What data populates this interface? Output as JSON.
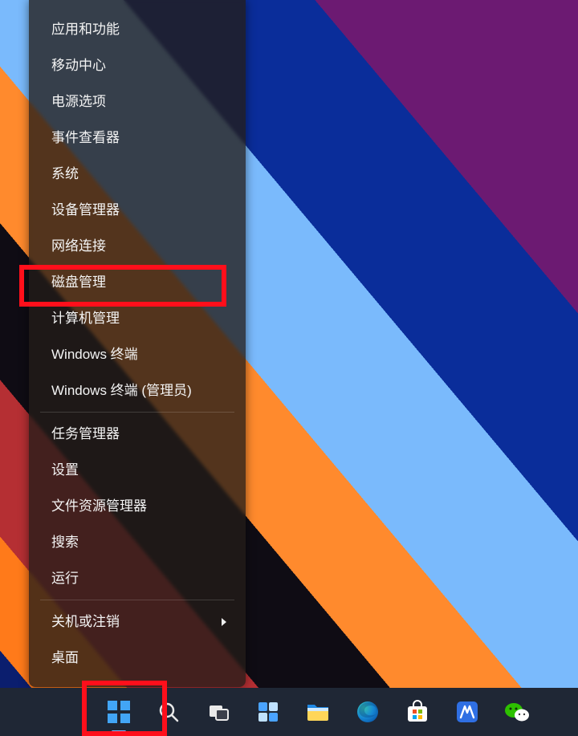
{
  "menu": {
    "items": [
      "应用和功能",
      "移动中心",
      "电源选项",
      "事件查看器",
      "系统",
      "设备管理器",
      "网络连接",
      "磁盘管理",
      "计算机管理",
      "Windows 终端",
      "Windows 终端 (管理员)",
      "任务管理器",
      "设置",
      "文件资源管理器",
      "搜索",
      "运行",
      "关机或注销",
      "桌面"
    ],
    "separators_after": [
      10,
      15
    ],
    "submenu_on": [
      16
    ],
    "highlight_index": 7
  },
  "taskbar": {
    "items": [
      {
        "name": "start",
        "icon": "start-icon",
        "active": true
      },
      {
        "name": "search",
        "icon": "search-icon"
      },
      {
        "name": "task-view",
        "icon": "task-view-icon"
      },
      {
        "name": "widgets",
        "icon": "widgets-icon"
      },
      {
        "name": "file-explorer",
        "icon": "file-explorer-icon"
      },
      {
        "name": "edge",
        "icon": "edge-icon"
      },
      {
        "name": "microsoft-store",
        "icon": "store-icon"
      },
      {
        "name": "unknown-app",
        "icon": "app-icon"
      },
      {
        "name": "wechat",
        "icon": "wechat-icon"
      }
    ]
  },
  "annotations": {
    "highlighted_menu_item": "磁盘管理",
    "highlighted_taskbar_item": "start"
  }
}
